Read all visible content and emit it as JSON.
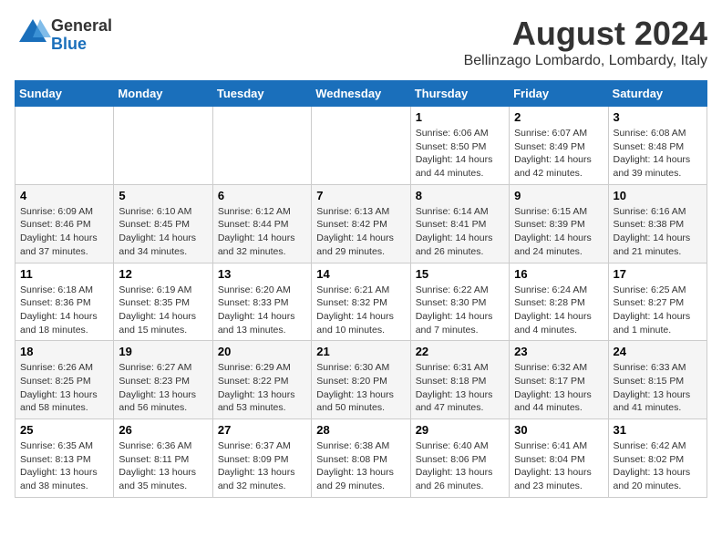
{
  "logo": {
    "general": "General",
    "blue": "Blue"
  },
  "title": "August 2024",
  "subtitle": "Bellinzago Lombardo, Lombardy, Italy",
  "days_of_week": [
    "Sunday",
    "Monday",
    "Tuesday",
    "Wednesday",
    "Thursday",
    "Friday",
    "Saturday"
  ],
  "weeks": [
    {
      "row_class": "week-row-1",
      "days": [
        {
          "num": "",
          "content": ""
        },
        {
          "num": "",
          "content": ""
        },
        {
          "num": "",
          "content": ""
        },
        {
          "num": "",
          "content": ""
        },
        {
          "num": "1",
          "content": "Sunrise: 6:06 AM\nSunset: 8:50 PM\nDaylight: 14 hours\nand 44 minutes."
        },
        {
          "num": "2",
          "content": "Sunrise: 6:07 AM\nSunset: 8:49 PM\nDaylight: 14 hours\nand 42 minutes."
        },
        {
          "num": "3",
          "content": "Sunrise: 6:08 AM\nSunset: 8:48 PM\nDaylight: 14 hours\nand 39 minutes."
        }
      ]
    },
    {
      "row_class": "week-row-2",
      "days": [
        {
          "num": "4",
          "content": "Sunrise: 6:09 AM\nSunset: 8:46 PM\nDaylight: 14 hours\nand 37 minutes."
        },
        {
          "num": "5",
          "content": "Sunrise: 6:10 AM\nSunset: 8:45 PM\nDaylight: 14 hours\nand 34 minutes."
        },
        {
          "num": "6",
          "content": "Sunrise: 6:12 AM\nSunset: 8:44 PM\nDaylight: 14 hours\nand 32 minutes."
        },
        {
          "num": "7",
          "content": "Sunrise: 6:13 AM\nSunset: 8:42 PM\nDaylight: 14 hours\nand 29 minutes."
        },
        {
          "num": "8",
          "content": "Sunrise: 6:14 AM\nSunset: 8:41 PM\nDaylight: 14 hours\nand 26 minutes."
        },
        {
          "num": "9",
          "content": "Sunrise: 6:15 AM\nSunset: 8:39 PM\nDaylight: 14 hours\nand 24 minutes."
        },
        {
          "num": "10",
          "content": "Sunrise: 6:16 AM\nSunset: 8:38 PM\nDaylight: 14 hours\nand 21 minutes."
        }
      ]
    },
    {
      "row_class": "week-row-3",
      "days": [
        {
          "num": "11",
          "content": "Sunrise: 6:18 AM\nSunset: 8:36 PM\nDaylight: 14 hours\nand 18 minutes."
        },
        {
          "num": "12",
          "content": "Sunrise: 6:19 AM\nSunset: 8:35 PM\nDaylight: 14 hours\nand 15 minutes."
        },
        {
          "num": "13",
          "content": "Sunrise: 6:20 AM\nSunset: 8:33 PM\nDaylight: 14 hours\nand 13 minutes."
        },
        {
          "num": "14",
          "content": "Sunrise: 6:21 AM\nSunset: 8:32 PM\nDaylight: 14 hours\nand 10 minutes."
        },
        {
          "num": "15",
          "content": "Sunrise: 6:22 AM\nSunset: 8:30 PM\nDaylight: 14 hours\nand 7 minutes."
        },
        {
          "num": "16",
          "content": "Sunrise: 6:24 AM\nSunset: 8:28 PM\nDaylight: 14 hours\nand 4 minutes."
        },
        {
          "num": "17",
          "content": "Sunrise: 6:25 AM\nSunset: 8:27 PM\nDaylight: 14 hours\nand 1 minute."
        }
      ]
    },
    {
      "row_class": "week-row-4",
      "days": [
        {
          "num": "18",
          "content": "Sunrise: 6:26 AM\nSunset: 8:25 PM\nDaylight: 13 hours\nand 58 minutes."
        },
        {
          "num": "19",
          "content": "Sunrise: 6:27 AM\nSunset: 8:23 PM\nDaylight: 13 hours\nand 56 minutes."
        },
        {
          "num": "20",
          "content": "Sunrise: 6:29 AM\nSunset: 8:22 PM\nDaylight: 13 hours\nand 53 minutes."
        },
        {
          "num": "21",
          "content": "Sunrise: 6:30 AM\nSunset: 8:20 PM\nDaylight: 13 hours\nand 50 minutes."
        },
        {
          "num": "22",
          "content": "Sunrise: 6:31 AM\nSunset: 8:18 PM\nDaylight: 13 hours\nand 47 minutes."
        },
        {
          "num": "23",
          "content": "Sunrise: 6:32 AM\nSunset: 8:17 PM\nDaylight: 13 hours\nand 44 minutes."
        },
        {
          "num": "24",
          "content": "Sunrise: 6:33 AM\nSunset: 8:15 PM\nDaylight: 13 hours\nand 41 minutes."
        }
      ]
    },
    {
      "row_class": "week-row-5",
      "days": [
        {
          "num": "25",
          "content": "Sunrise: 6:35 AM\nSunset: 8:13 PM\nDaylight: 13 hours\nand 38 minutes."
        },
        {
          "num": "26",
          "content": "Sunrise: 6:36 AM\nSunset: 8:11 PM\nDaylight: 13 hours\nand 35 minutes."
        },
        {
          "num": "27",
          "content": "Sunrise: 6:37 AM\nSunset: 8:09 PM\nDaylight: 13 hours\nand 32 minutes."
        },
        {
          "num": "28",
          "content": "Sunrise: 6:38 AM\nSunset: 8:08 PM\nDaylight: 13 hours\nand 29 minutes."
        },
        {
          "num": "29",
          "content": "Sunrise: 6:40 AM\nSunset: 8:06 PM\nDaylight: 13 hours\nand 26 minutes."
        },
        {
          "num": "30",
          "content": "Sunrise: 6:41 AM\nSunset: 8:04 PM\nDaylight: 13 hours\nand 23 minutes."
        },
        {
          "num": "31",
          "content": "Sunrise: 6:42 AM\nSunset: 8:02 PM\nDaylight: 13 hours\nand 20 minutes."
        }
      ]
    }
  ]
}
